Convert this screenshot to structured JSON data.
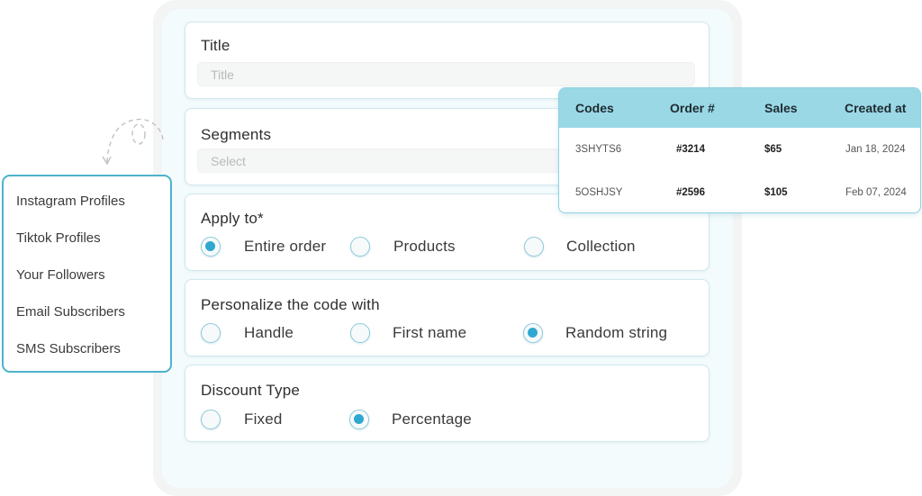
{
  "form": {
    "title_card": {
      "label": "Title",
      "placeholder": "Title",
      "value": ""
    },
    "segments_card": {
      "label": "Segments",
      "placeholder": "Select",
      "value": ""
    },
    "apply_to": {
      "label": "Apply to*",
      "options": [
        {
          "label": "Entire order",
          "checked": true
        },
        {
          "label": "Products",
          "checked": false
        },
        {
          "label": "Collection",
          "checked": false
        }
      ]
    },
    "personalize": {
      "label": "Personalize the code with",
      "options": [
        {
          "label": "Handle",
          "checked": false
        },
        {
          "label": "First name",
          "checked": false
        },
        {
          "label": "Random string",
          "checked": true
        }
      ]
    },
    "discount_type": {
      "label": "Discount Type",
      "options": [
        {
          "label": "Fixed",
          "checked": false
        },
        {
          "label": "Percentage",
          "checked": true
        }
      ]
    }
  },
  "segment_dropdown": {
    "items": [
      "Instagram Profiles",
      "Tiktok Profiles",
      "Your Followers",
      "Email Subscribers",
      "SMS Subscribers"
    ]
  },
  "codes_table": {
    "columns": [
      "Codes",
      "Order #",
      "Sales",
      "Created at"
    ],
    "rows": [
      {
        "code": "3SHYTS6",
        "order": "#3214",
        "sales": "$65",
        "created": "Jan 18, 2024"
      },
      {
        "code": "5OSHJSY",
        "order": "#2596",
        "sales": "$105",
        "created": "Feb 07, 2024"
      }
    ]
  },
  "icons": {
    "decor": "dashed-loop-arrow-icon",
    "radio_checked": "radio-checked-icon",
    "radio_unchecked": "radio-unchecked-icon"
  },
  "colors": {
    "accent": "#2fa8d0",
    "table_header": "#9ad8e6",
    "dropdown_border": "#4db3cc",
    "card_border": "#cfe8ee"
  }
}
